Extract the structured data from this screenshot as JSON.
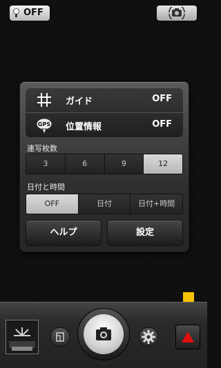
{
  "topbar": {
    "flash_label": "OFF",
    "flash_icon": "lightbulb-icon",
    "switch_icon": "camera-switch-icon"
  },
  "settings": {
    "rows": [
      {
        "icon": "grid-icon",
        "label": "ガイド",
        "value": "OFF"
      },
      {
        "icon": "gps-icon",
        "icon_text": "GPS",
        "label": "位置情報",
        "value": "OFF"
      }
    ],
    "burst": {
      "label": "連写枚数",
      "options": [
        "3",
        "6",
        "9",
        "12"
      ],
      "selected": "12"
    },
    "datetime": {
      "label": "日付と時間",
      "options": [
        "OFF",
        "日付",
        "日付+時間"
      ],
      "selected": "OFF"
    },
    "help_label": "ヘルプ",
    "config_label": "設定"
  },
  "bottombar": {
    "thumbnail_icon": "gallery-thumbnail",
    "mode_icon": "frame-icon",
    "shutter_icon": "camera-icon",
    "settings_icon": "gear-icon",
    "expand_icon": "triangle-up-icon"
  },
  "colors": {
    "accent_red": "#e01010",
    "hint_arrow": "#f6c200"
  }
}
